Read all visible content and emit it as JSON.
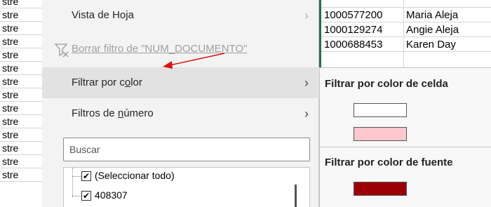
{
  "sheet": {
    "left_cells": [
      "stre",
      "stre",
      "stre",
      "stre",
      "stre",
      "stre",
      "stre",
      "stre",
      "stre",
      "stre",
      "stre",
      "stre",
      "stre",
      "stre"
    ],
    "rows": [
      {
        "doc": "1000577200",
        "name": "Maria Aleja"
      },
      {
        "doc": "1000129274",
        "name": "Angie Aleja"
      },
      {
        "doc": "1000688453",
        "name": "Karen Day"
      }
    ]
  },
  "menu": {
    "items": [
      {
        "label": "Vista de Hoja"
      },
      {
        "label": "Borrar filtro de \"NUM_DOCUMENTO\""
      },
      {
        "label_pre": "Filtrar por c",
        "label_u": "o",
        "label_post": "lor"
      },
      {
        "label_pre": "Filtros de ",
        "label_u": "n",
        "label_post": "úmero"
      }
    ],
    "search_placeholder": "Buscar",
    "list": [
      "(Seleccionar todo)",
      "408307"
    ]
  },
  "submenu": {
    "cell_heading": "Filtrar por color de celda",
    "font_heading": "Filtrar por color de fuente",
    "cell_colors": [
      "#ffffff",
      "#ffc7ce"
    ],
    "font_colors": [
      "#9c0006"
    ]
  },
  "colors": {
    "accent_green": "#217346",
    "arrow": "#e01010"
  }
}
